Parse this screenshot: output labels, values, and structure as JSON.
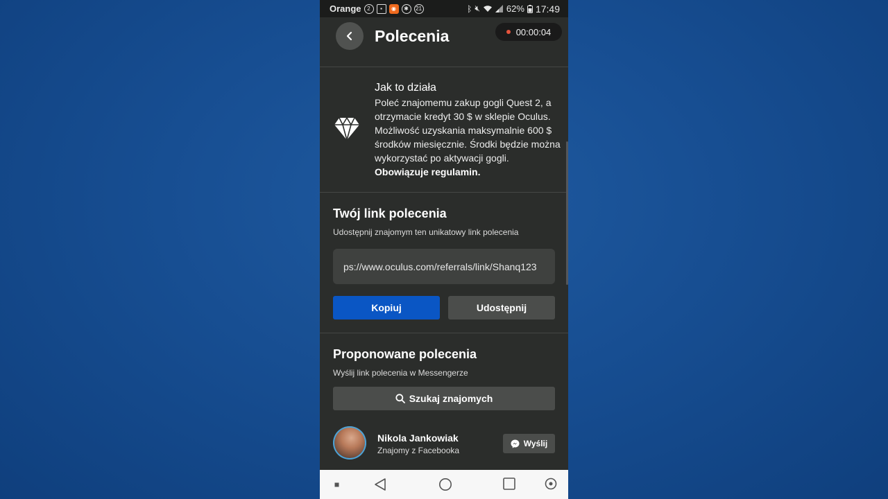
{
  "status_bar": {
    "carrier": "Orange",
    "icon_badges": [
      "2",
      "21"
    ],
    "battery": "62%",
    "time": "17:49"
  },
  "header": {
    "title": "Polecenia",
    "recording_timer": "00:00:04"
  },
  "how_it_works": {
    "title": "Jak to działa",
    "body": "Poleć znajomemu zakup gogli Quest 2, a otrzymacie kredyt 30 $ w sklepie Oculus. Możliwość uzyskania maksymalnie 600 $ środków miesięcznie. Środki będzie można wykorzystać po aktywacji gogli.",
    "terms": "Obowiązuje regulamin.",
    "icon": "diamond-icon"
  },
  "referral_link": {
    "title": "Twój link polecenia",
    "subtitle": "Udostępnij znajomym ten unikatowy link polecenia",
    "link": "ps://www.oculus.com/referrals/link/Shanq123",
    "copy_label": "Kopiuj",
    "share_label": "Udostępnij"
  },
  "suggested": {
    "title": "Proponowane polecenia",
    "subtitle": "Wyślij link polecenia w Messengerze",
    "search_label": "Szukaj znajomych",
    "friends": [
      {
        "name": "Nikola Jankowiak",
        "relation": "Znajomy z Facebooka",
        "send_label": "Wyślij"
      }
    ]
  },
  "colors": {
    "background": "#2b2d2b",
    "primary_button": "#0a56c4",
    "secondary_button": "#4b4d4b",
    "recording_dot": "#e5533c"
  }
}
